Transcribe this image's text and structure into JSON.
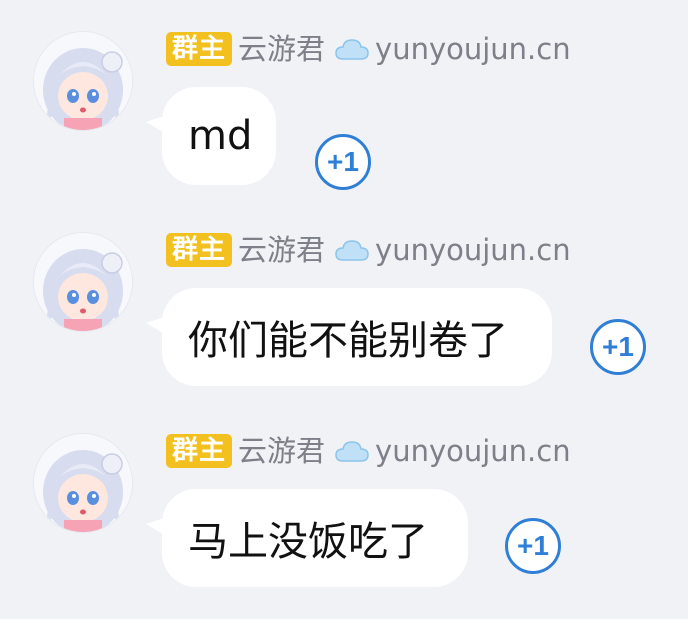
{
  "messages": [
    {
      "badge": "群主",
      "nickname": "云游君",
      "site": "yunyoujun.cn",
      "text": "md",
      "plus_one": "+1"
    },
    {
      "badge": "群主",
      "nickname": "云游君",
      "site": "yunyoujun.cn",
      "text": "你们能不能别卷了",
      "plus_one": "+1"
    },
    {
      "badge": "群主",
      "nickname": "云游君",
      "site": "yunyoujun.cn",
      "text": "马上没饭吃了",
      "plus_one": "+1"
    }
  ],
  "colors": {
    "background": "#f1f2f6",
    "badge": "#f2c01f",
    "accent": "#2f7fd6",
    "name_text": "#7d8088"
  },
  "icons": {
    "header_icon": "cloud-icon",
    "avatar": "anime-girl-avatar"
  }
}
